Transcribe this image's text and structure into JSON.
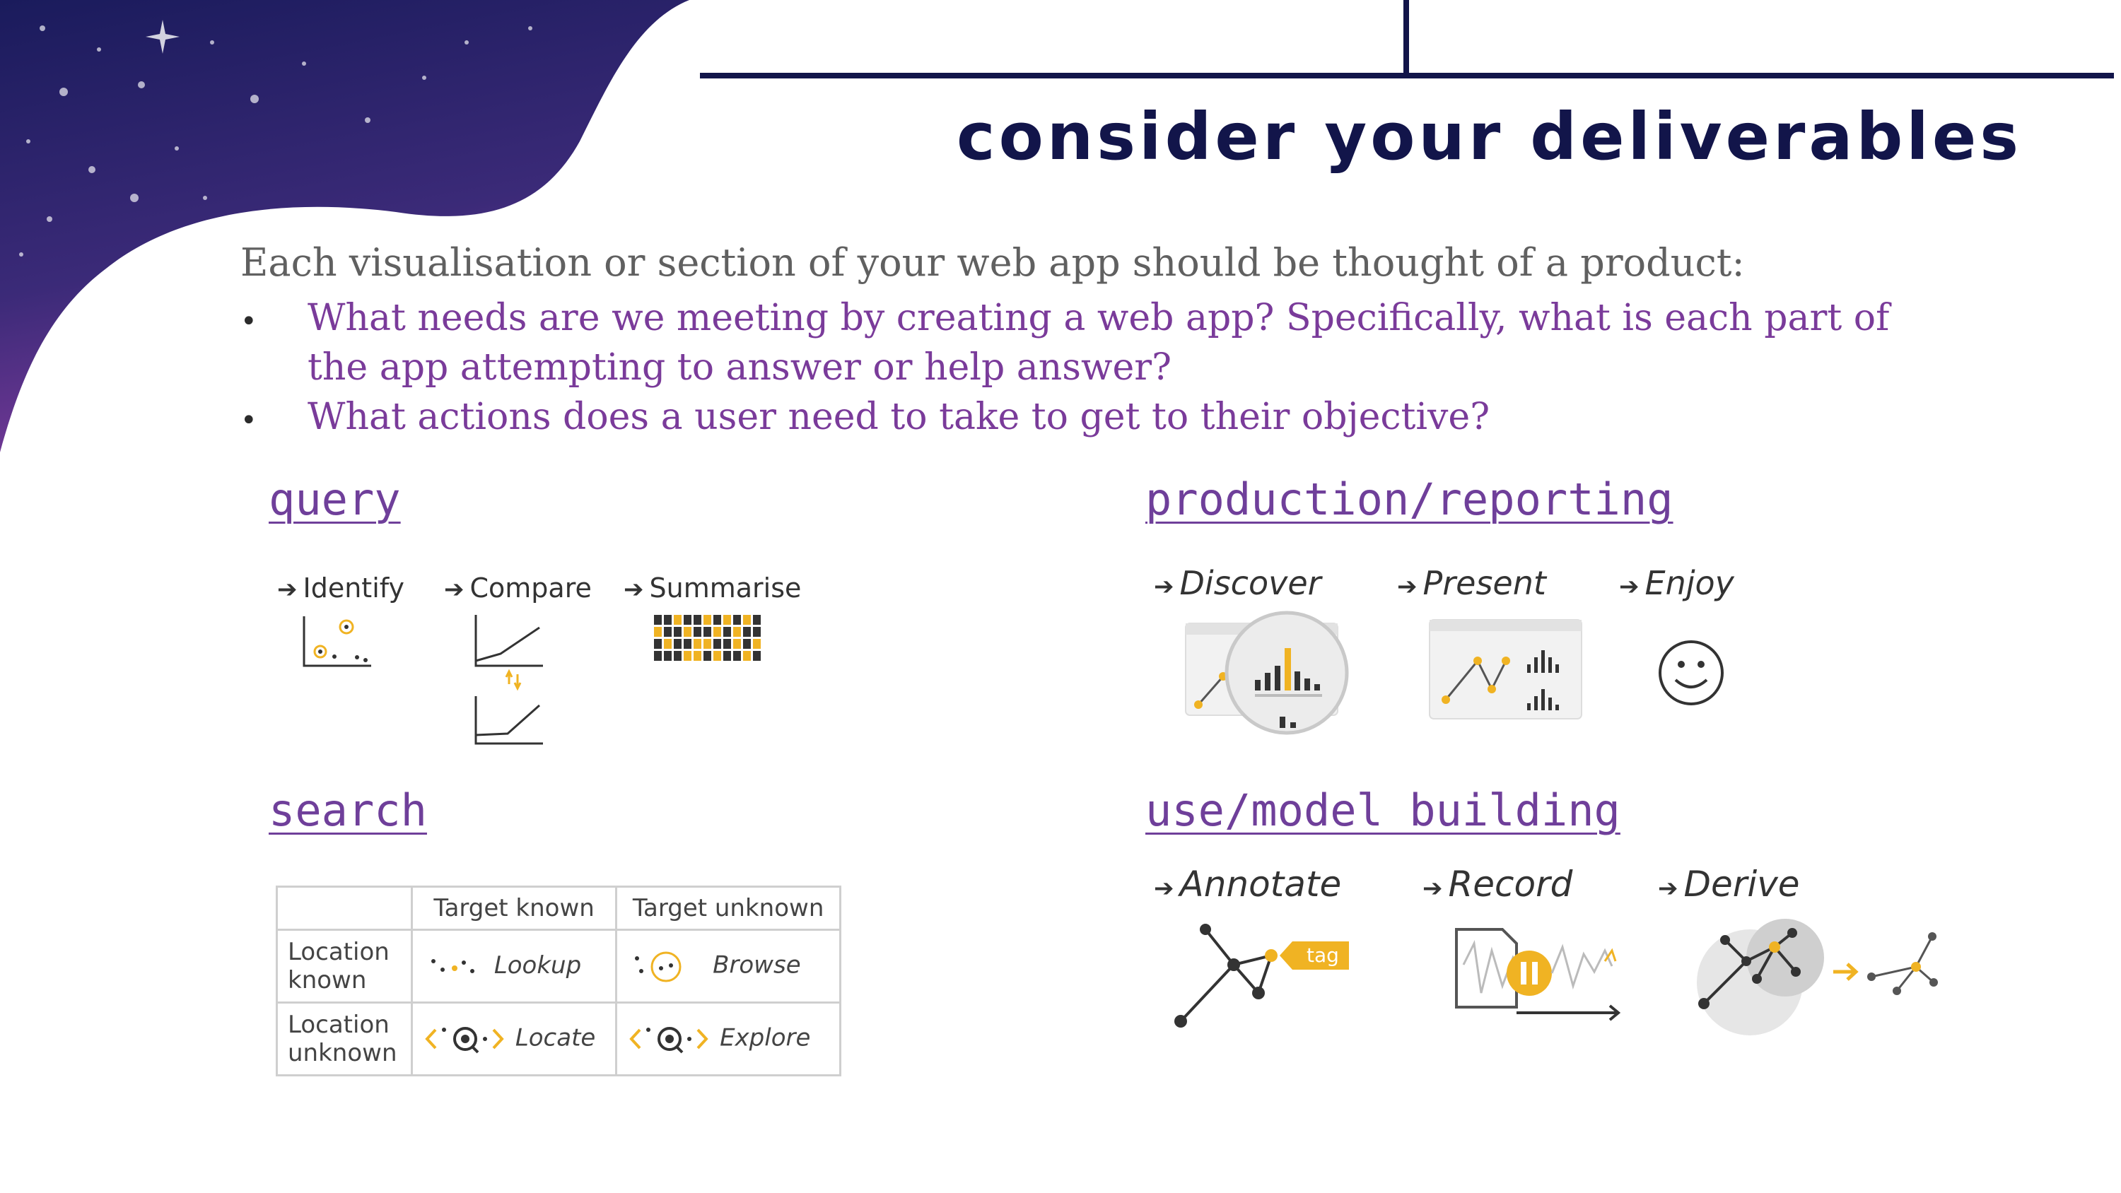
{
  "slide": {
    "title": "consider your deliverables",
    "intro": "Each visualisation or section of your web app should be thought of a product:",
    "bullets": [
      {
        "line1": "What needs are we meeting by creating a web app? Specifically, what is each part of",
        "line2": "the app attempting to answer or help answer?"
      },
      {
        "line1": "What actions does a user need to take to get to their objective?"
      }
    ],
    "bullet_symbol": "•"
  },
  "query": {
    "heading": "query",
    "items": [
      "Identify",
      "Compare",
      "Summarise"
    ]
  },
  "production": {
    "heading": "production/reporting",
    "items": [
      "Discover",
      "Present",
      "Enjoy"
    ]
  },
  "search": {
    "heading": "search",
    "table": {
      "col_headers": [
        "Target known",
        "Target unknown"
      ],
      "rows": [
        {
          "label_line1": "Location",
          "label_line2": "known",
          "cells": [
            "Lookup",
            "Browse"
          ]
        },
        {
          "label_line1": "Location",
          "label_line2": "unknown",
          "cells": [
            "Locate",
            "Explore"
          ]
        }
      ]
    }
  },
  "use": {
    "heading": "use/model building",
    "items": [
      "Annotate",
      "Record",
      "Derive"
    ],
    "tag_label": "tag"
  },
  "colors": {
    "navy": "#12154a",
    "purple": "#7a3b9a",
    "accent": "#f0b323"
  }
}
